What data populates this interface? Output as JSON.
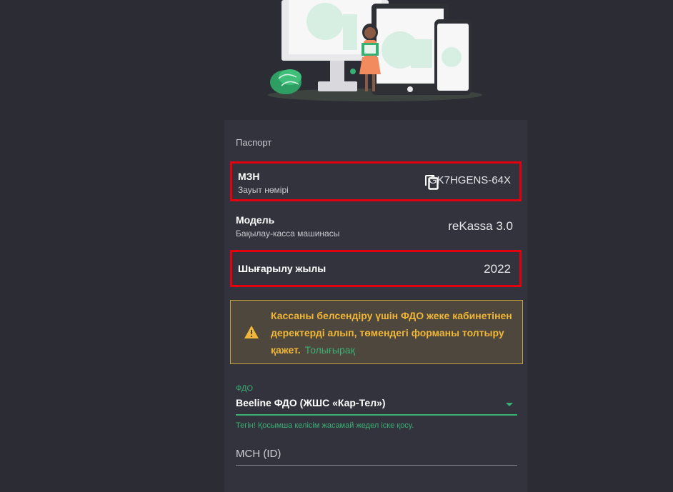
{
  "passport": {
    "section_title": "Паспорт",
    "serial": {
      "label": "МЗН",
      "sublabel": "Зауыт нөмірі",
      "value": "GK7HGENS-64X",
      "copy_icon": "copy-icon"
    },
    "model": {
      "label": "Модель",
      "sublabel": "Бақылау-касса машинасы",
      "value": "reKassa 3.0"
    },
    "year": {
      "label": "Шығарылу жылы",
      "value": "2022"
    }
  },
  "warning": {
    "icon": "warning-icon",
    "text": "Кассаны белсендіру үшін ФДО жеке кабинетінен деректерді алып, төмендегі форманы толтыру қажет.",
    "link": "Толығырақ"
  },
  "form": {
    "ofd": {
      "label": "ФДО",
      "value": "Beeline ФДО (ЖШС «Кар-Тел»)",
      "helper": "Тегін! Қосымша келісім жасамай жедел іске қосу."
    },
    "mch": {
      "placeholder": "МСН (ID)"
    }
  },
  "colors": {
    "background": "#2c2c35",
    "card": "#33333d",
    "accent_green": "#38b073",
    "warning_text": "#f2b636",
    "highlight_red": "#e3000f"
  }
}
